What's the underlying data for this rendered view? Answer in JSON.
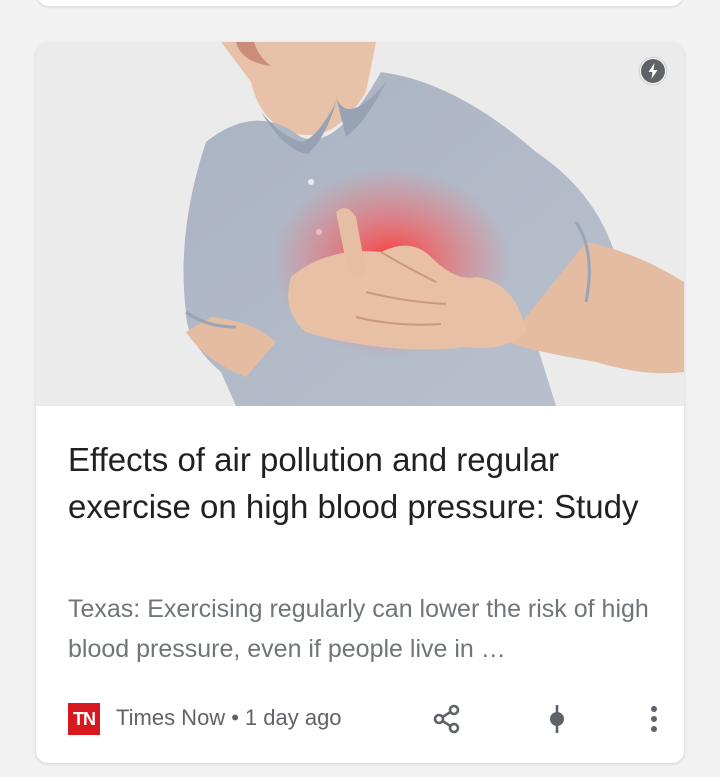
{
  "article": {
    "headline": "Effects of air pollution and regular exercise on high blood pressure: Study",
    "snippet": "Texas: Exercising regularly can lower the risk of high blood pressure, even if people live in …",
    "source": {
      "logo_text": "TN",
      "name": "Times Now",
      "separator": "•",
      "time": "1 day ago"
    },
    "image": {
      "subject": "man clutching chest with red glow",
      "badge_icon": "amp-lightning-icon"
    }
  },
  "actions": {
    "share_icon": "share-icon",
    "pin_icon": "pin-icon",
    "more_icon": "more-vert-icon"
  },
  "colors": {
    "card_bg": "#ffffff",
    "page_bg": "#f2f2f2",
    "headline": "#202124",
    "snippet": "#70757a",
    "icon": "#5f6368",
    "logo_red": "#d7191f"
  }
}
